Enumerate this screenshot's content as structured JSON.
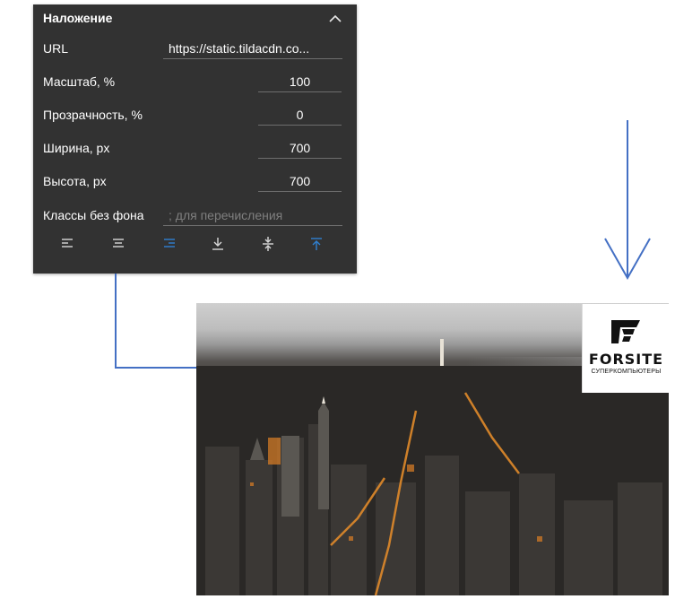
{
  "overlay_panel": {
    "title": "Наложение",
    "url_label": "URL",
    "url_value": "https://static.tildacdn.co...",
    "scale_label": "Масштаб, %",
    "scale_value": "100",
    "opacity_label": "Прозрачность, %",
    "opacity_value": "0",
    "width_label": "Ширина, px",
    "width_value": "700",
    "height_label": "Высота, px",
    "height_value": "700",
    "classes_label": "Классы без фона",
    "classes_placeholder": "; для перечисления",
    "align_buttons": [
      {
        "name": "align-left",
        "active": false
      },
      {
        "name": "align-center",
        "active": false
      },
      {
        "name": "align-right",
        "active": true
      },
      {
        "name": "align-bottom",
        "active": false
      },
      {
        "name": "align-middle",
        "active": false
      },
      {
        "name": "align-top",
        "active": true
      }
    ]
  },
  "preview": {
    "logo_brand": "FORSITE",
    "logo_tagline": "СУПЕРКОМПЬЮТЕРЫ"
  },
  "colors": {
    "panel_bg": "#323232",
    "active_icon": "#2f80d1",
    "inactive_icon": "#d9d9d9",
    "connector": "#4470c4"
  }
}
